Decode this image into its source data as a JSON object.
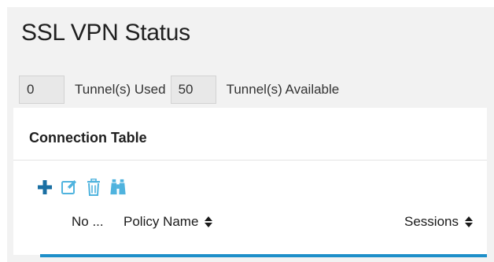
{
  "page": {
    "title": "SSL VPN Status"
  },
  "tunnels": {
    "used_value": "0",
    "used_label": "Tunnel(s) Used",
    "available_value": "50",
    "available_label": "Tunnel(s) Available"
  },
  "connection_table": {
    "title": "Connection Table",
    "toolbar": {
      "icons": [
        "plus-icon",
        "edit-icon",
        "trash-icon",
        "binoculars-icon"
      ]
    },
    "columns": [
      {
        "label": "No ...",
        "sortable": false
      },
      {
        "label": "Policy Name",
        "sortable": true
      },
      {
        "label": "Sessions",
        "sortable": true
      }
    ]
  },
  "colors": {
    "accent": "#1d8fc9",
    "background": "#f2f2f2",
    "panel": "#ffffff"
  }
}
